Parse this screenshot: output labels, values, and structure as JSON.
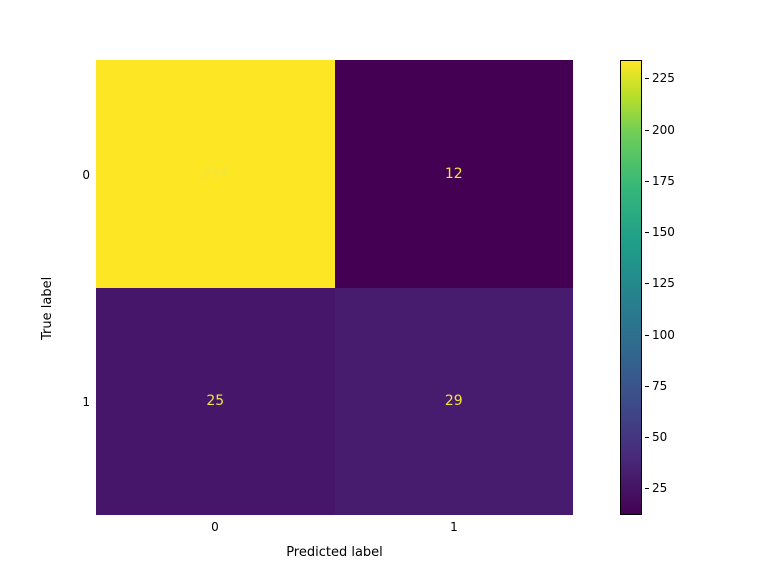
{
  "chart_data": {
    "type": "heatmap",
    "title": "",
    "xlabel": "Predicted label",
    "ylabel": "True label",
    "x_categories": [
      "0",
      "1"
    ],
    "y_categories": [
      "0",
      "1"
    ],
    "matrix": [
      [
        234,
        12
      ],
      [
        25,
        29
      ]
    ],
    "colormap": "viridis",
    "colorbar": {
      "vmin": 12,
      "vmax": 234,
      "ticks": [
        25,
        50,
        75,
        100,
        125,
        150,
        175,
        200,
        225
      ]
    },
    "cell_colors": [
      [
        "#fde725",
        "#440154"
      ],
      [
        "#46166a",
        "#471b6e"
      ]
    ],
    "annotation_color": "#f0e442"
  }
}
